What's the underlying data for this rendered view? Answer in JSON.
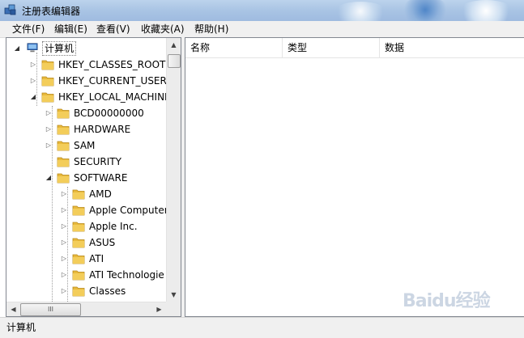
{
  "window": {
    "title": "注册表编辑器"
  },
  "menu": [
    "文件(F)",
    "编辑(E)",
    "查看(V)",
    "收藏夹(A)",
    "帮助(H)"
  ],
  "tree": {
    "root": "计算机",
    "hives": [
      "HKEY_CLASSES_ROOT",
      "HKEY_CURRENT_USER",
      "HKEY_LOCAL_MACHINE"
    ],
    "hklm_children": [
      "BCD00000000",
      "HARDWARE",
      "SAM",
      "SECURITY",
      "SOFTWARE"
    ],
    "software_children": [
      "AMD",
      "Apple Computer",
      "Apple Inc.",
      "ASUS",
      "ATI",
      "ATI Technologie",
      "Classes"
    ]
  },
  "hscroll_grip": "III",
  "list": {
    "columns": [
      "名称",
      "类型",
      "数据"
    ]
  },
  "watermark": "Baidu经验",
  "status": "计算机",
  "colors": {
    "folder": "#e8b93c",
    "titlebar": "#a9c4e4"
  },
  "icons": {
    "app": "regedit-icon",
    "folder": "folder-icon",
    "computer": "computer-icon"
  }
}
